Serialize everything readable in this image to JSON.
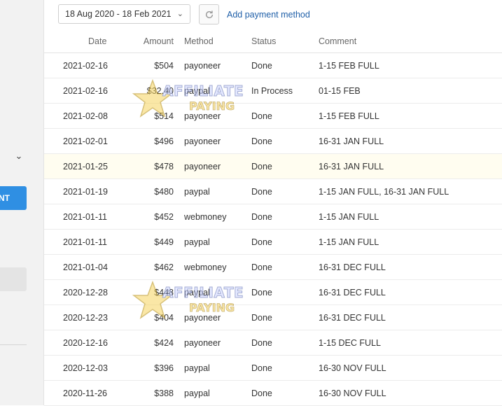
{
  "sidebar": {
    "button_label": "NT"
  },
  "toolbar": {
    "date_range": "18 Aug 2020 - 18 Feb 2021",
    "add_payment": "Add payment method"
  },
  "table": {
    "headers": {
      "date": "Date",
      "amount": "Amount",
      "method": "Method",
      "status": "Status",
      "comment": "Comment"
    },
    "rows": [
      {
        "date": "2021-02-16",
        "amount": "$504",
        "method": "payoneer",
        "status": "Done",
        "comment": "1-15 FEB FULL"
      },
      {
        "date": "2021-02-16",
        "amount": "$32.40",
        "method": "paypal",
        "status": "In Process",
        "comment": "01-15 FEB"
      },
      {
        "date": "2021-02-08",
        "amount": "$514",
        "method": "payoneer",
        "status": "Done",
        "comment": "1-15 FEB FULL"
      },
      {
        "date": "2021-02-01",
        "amount": "$496",
        "method": "payoneer",
        "status": "Done",
        "comment": "16-31 JAN FULL"
      },
      {
        "date": "2021-01-25",
        "amount": "$478",
        "method": "payoneer",
        "status": "Done",
        "comment": "16-31 JAN FULL"
      },
      {
        "date": "2021-01-19",
        "amount": "$480",
        "method": "paypal",
        "status": "Done",
        "comment": "1-15 JAN FULL, 16-31 JAN FULL"
      },
      {
        "date": "2021-01-11",
        "amount": "$452",
        "method": "webmoney",
        "status": "Done",
        "comment": "1-15 JAN FULL"
      },
      {
        "date": "2021-01-11",
        "amount": "$449",
        "method": "paypal",
        "status": "Done",
        "comment": "1-15 JAN FULL"
      },
      {
        "date": "2021-01-04",
        "amount": "$462",
        "method": "webmoney",
        "status": "Done",
        "comment": "16-31 DEC FULL"
      },
      {
        "date": "2020-12-28",
        "amount": "$448",
        "method": "paypal",
        "status": "Done",
        "comment": "16-31 DEC FULL"
      },
      {
        "date": "2020-12-23",
        "amount": "$404",
        "method": "payoneer",
        "status": "Done",
        "comment": "16-31 DEC FULL"
      },
      {
        "date": "2020-12-16",
        "amount": "$424",
        "method": "payoneer",
        "status": "Done",
        "comment": "1-15 DEC FULL"
      },
      {
        "date": "2020-12-03",
        "amount": "$396",
        "method": "paypal",
        "status": "Done",
        "comment": "16-30 NOV FULL"
      },
      {
        "date": "2020-11-26",
        "amount": "$388",
        "method": "paypal",
        "status": "Done",
        "comment": "16-30 NOV FULL"
      }
    ]
  },
  "watermark": {
    "line1": "AFFILIATE",
    "line2": "PAYING"
  },
  "colors": {
    "accent": "#2f8fe3",
    "link": "#1f5fa8",
    "highlight_row": "#fffdf0"
  }
}
